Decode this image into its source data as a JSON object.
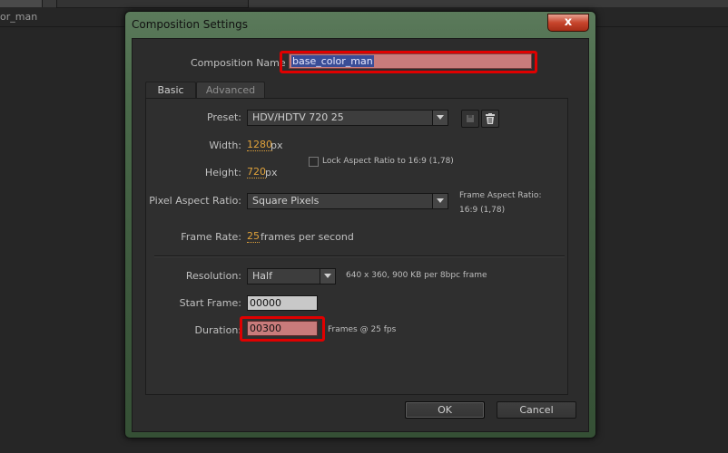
{
  "background": {
    "label": "or_man"
  },
  "dialog": {
    "title": "Composition Settings",
    "close_label": "x",
    "name_label": "Composition Name",
    "name_value": "base_color_man",
    "tabs": [
      {
        "label": "Basic"
      },
      {
        "label": "Advanced"
      }
    ],
    "preset": {
      "label": "Preset:",
      "value": "HDV/HDTV 720 25"
    },
    "width": {
      "label": "Width:",
      "value": "1280",
      "unit": "px"
    },
    "height": {
      "label": "Height:",
      "value": "720",
      "unit": "px"
    },
    "lock_aspect": {
      "label": "Lock Aspect Ratio to 16:9 (1,78)",
      "checked": false
    },
    "pixel_aspect": {
      "label": "Pixel Aspect Ratio:",
      "value": "Square Pixels"
    },
    "frame_aspect": {
      "label": "Frame Aspect Ratio:",
      "value": "16:9 (1,78)"
    },
    "frame_rate": {
      "label": "Frame Rate:",
      "value": "25",
      "unit": "frames per second"
    },
    "resolution": {
      "label": "Resolution:",
      "value": "Half",
      "info": "640 x 360, 900 KB per 8bpc frame"
    },
    "start_frame": {
      "label": "Start Frame:",
      "value": "00000"
    },
    "duration": {
      "label": "Duration:",
      "value": "00300",
      "info": "Frames @ 25 fps"
    },
    "ok_label": "OK",
    "cancel_label": "Cancel"
  },
  "colors": {
    "accent_value": "#e0a23b",
    "highlight": "#e00000"
  }
}
